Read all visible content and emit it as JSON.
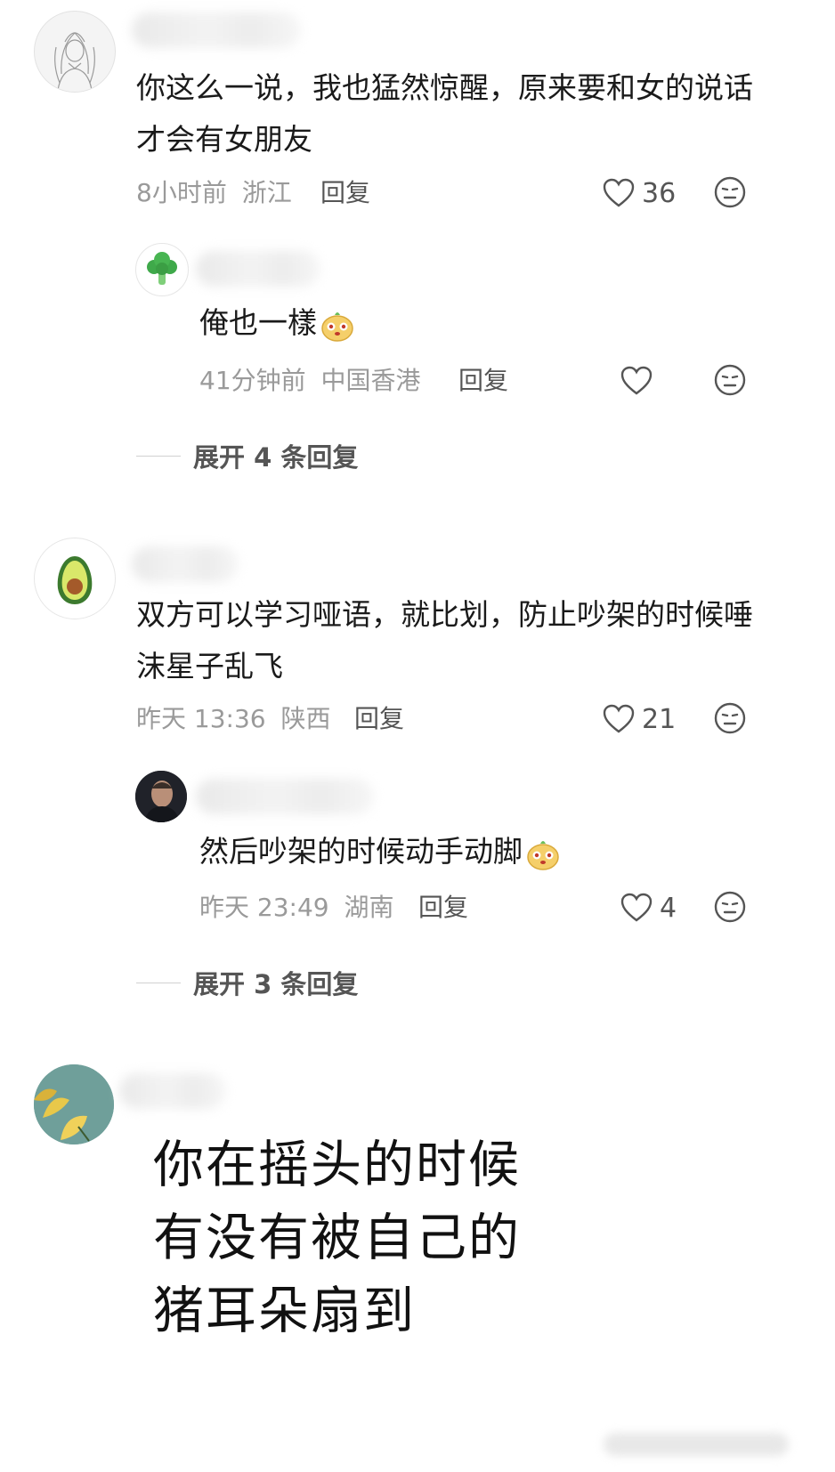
{
  "comments": [
    {
      "text": "你这么一说，我也猛然惊醒，原来要和女的说话才会有女朋友",
      "time": "8小时前",
      "location": "浙江",
      "reply_label": "回复",
      "likes": "36",
      "avatar_icon": "anime-sketch-avatar",
      "replies": [
        {
          "text": "俺也一樣",
          "time": "41分钟前",
          "location": "中国香港",
          "reply_label": "回复",
          "likes": "",
          "avatar_icon": "broccoli-avatar",
          "emoji": "yellow-mascot-emoji"
        }
      ],
      "expand_label": "展开 4 条回复"
    },
    {
      "text": "双方可以学习哑语，就比划，防止吵架的时候唾沫星子乱飞",
      "time": "昨天 13:36",
      "location": "陕西",
      "reply_label": "回复",
      "likes": "21",
      "avatar_icon": "avocado-avatar",
      "replies": [
        {
          "text": "然后吵架的时候动手动脚",
          "time": "昨天 23:49",
          "location": "湖南",
          "reply_label": "回复",
          "likes": "4",
          "avatar_icon": "man-photo-avatar",
          "emoji": "yellow-mascot-emoji"
        }
      ],
      "expand_label": "展开 3 条回复"
    },
    {
      "text": "你在摇头的时候有没有被自己的猪耳朵扇到",
      "avatar_icon": "ginkgo-leaf-avatar"
    }
  ],
  "colors": {
    "text": "#1a1a1a",
    "meta": "#9a9a9a",
    "action": "#555555",
    "background": "#ffffff"
  }
}
